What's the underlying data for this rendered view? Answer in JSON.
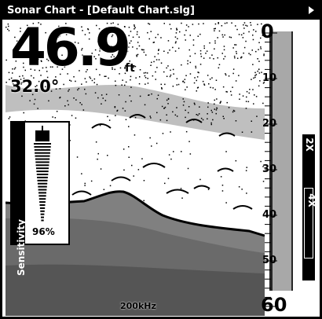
{
  "window": {
    "title": "Sonar Chart - [Default Chart.slg]"
  },
  "readout": {
    "depth": "46.9",
    "depth_unit": "ft",
    "temperature": "32.0°"
  },
  "sensitivity": {
    "label": "Sensitivity",
    "value": "96%",
    "level_fraction": 0.96
  },
  "depth_scale": {
    "labels": [
      "0",
      "10",
      "20",
      "30",
      "40",
      "50",
      "60"
    ],
    "min": 0,
    "max": 60
  },
  "frequency": "200kHz",
  "zoom": {
    "options": [
      "2X",
      "4X"
    ],
    "selected": "4X"
  },
  "icons": {
    "menu_arrow": "triangle-right-icon",
    "slider": "sensitivity-slider-icon"
  }
}
